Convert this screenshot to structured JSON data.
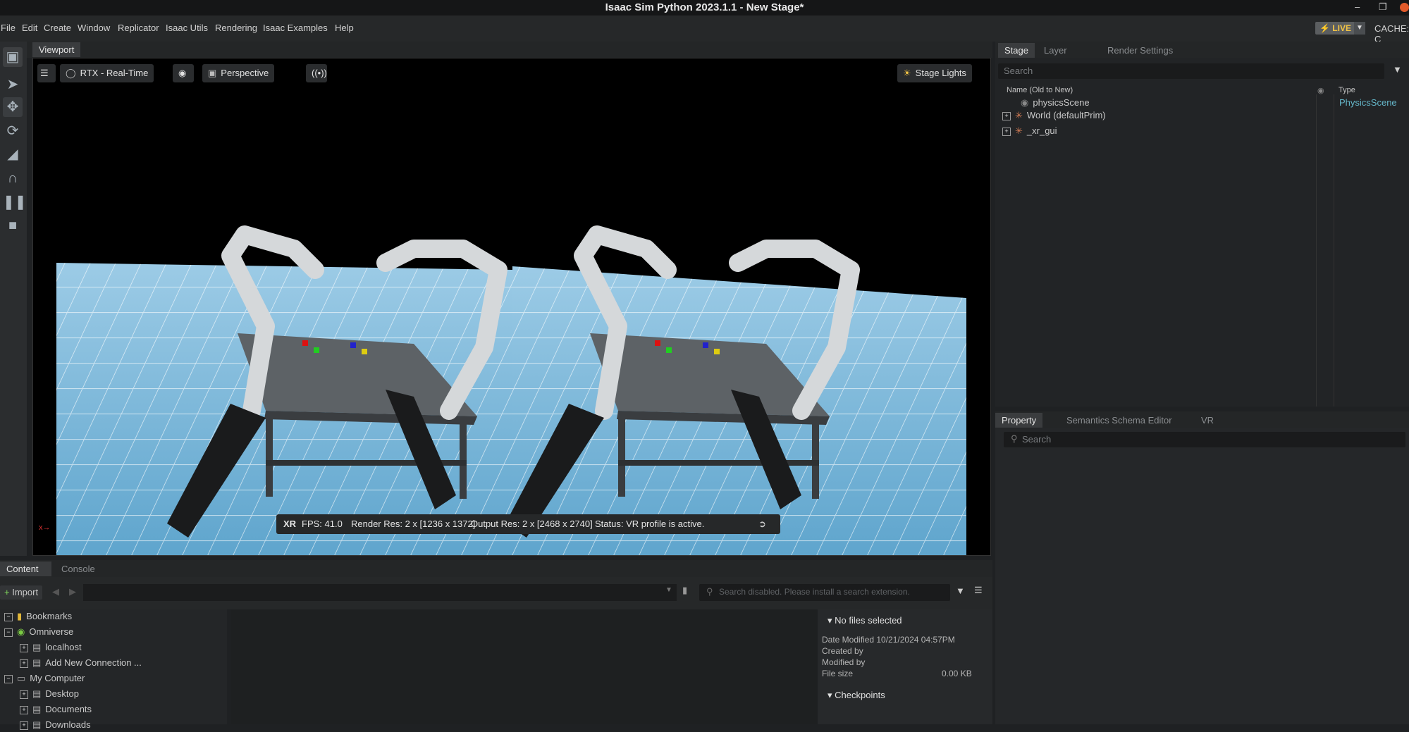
{
  "window": {
    "title": "Isaac Sim Python 2023.1.1 - New Stage*"
  },
  "menu": [
    "File",
    "Edit",
    "Create",
    "Window",
    "Replicator",
    "Isaac Utils",
    "Rendering",
    "Isaac Examples",
    "Help"
  ],
  "live_label": "LIVE",
  "cache_label": "CACHE: C",
  "viewport": {
    "tab": "Viewport",
    "renderer": "RTX - Real-Time",
    "camera": "Perspective",
    "lights": "Stage Lights",
    "status": {
      "xr": "XR",
      "fps": "FPS: 41.0",
      "render_res": "Render Res: 2 x [1236 x 1372]",
      "output_res": "Output Res: 2 x [2468 x 2740]",
      "status": "Status: VR profile is active."
    }
  },
  "stage": {
    "tabs": [
      "Stage",
      "Layer",
      "Render Settings"
    ],
    "search_placeholder": "Search",
    "col_name": "Name (Old to New)",
    "col_type": "Type",
    "rows": [
      {
        "name": "physicsScene",
        "type": "PhysicsScene"
      },
      {
        "name": "World (defaultPrim)",
        "type": ""
      },
      {
        "name": "_xr_gui",
        "type": ""
      }
    ]
  },
  "property": {
    "tabs": [
      "Property",
      "Semantics Schema Editor",
      "VR"
    ],
    "search_placeholder": "Search"
  },
  "content": {
    "tabs": [
      "Content",
      "Console"
    ],
    "import_label": "Import",
    "search_placeholder": "Search disabled. Please install a search extension.",
    "tree": [
      {
        "label": "Bookmarks",
        "level": 0,
        "exp": "−"
      },
      {
        "label": "Omniverse",
        "level": 0,
        "exp": "−"
      },
      {
        "label": "localhost",
        "level": 1,
        "exp": "+"
      },
      {
        "label": "Add New Connection ...",
        "level": 1,
        "exp": "+"
      },
      {
        "label": "My Computer",
        "level": 0,
        "exp": "−"
      },
      {
        "label": "Desktop",
        "level": 1,
        "exp": "+"
      },
      {
        "label": "Documents",
        "level": 1,
        "exp": "+"
      },
      {
        "label": "Downloads",
        "level": 1,
        "exp": "+"
      }
    ],
    "detail": {
      "header": "No files selected",
      "date_modified": "Date Modified 10/21/2024 04:57PM",
      "created_by": "Created by",
      "modified_by": "Modified by",
      "file_size_label": "File size",
      "file_size_value": "0.00 KB",
      "checkpoints": "Checkpoints"
    }
  }
}
